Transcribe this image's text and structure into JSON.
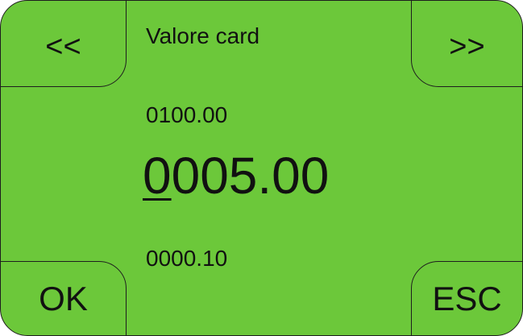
{
  "nav": {
    "prev_label": "<<",
    "next_label": ">>"
  },
  "actions": {
    "ok_label": "OK",
    "esc_label": "ESC"
  },
  "title": "Valore card",
  "values": {
    "upper": "0100.00",
    "main_cursor_digit": "0",
    "main_rest": "005.00",
    "lower": "0000.10"
  },
  "colors": {
    "background": "#6cc83a",
    "border": "#1e1e1e",
    "text": "#111111"
  }
}
